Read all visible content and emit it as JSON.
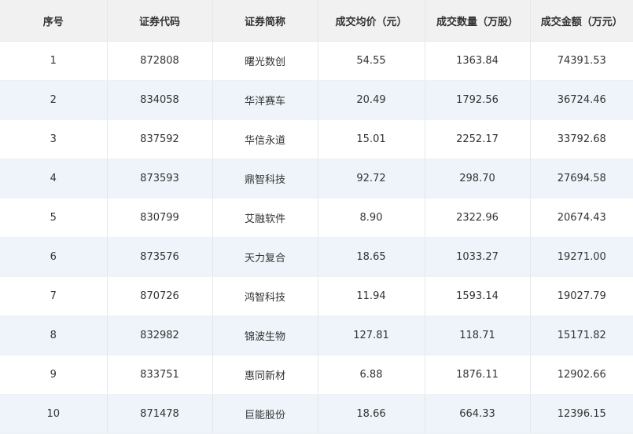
{
  "table": {
    "headers": [
      "序号",
      "证券代码",
      "证券简称",
      "成交均价（元）",
      "成交数量（万股）",
      "成交金额（万元）"
    ],
    "rows": [
      [
        "1",
        "872808",
        "曙光数创",
        "54.55",
        "1363.84",
        "74391.53"
      ],
      [
        "2",
        "834058",
        "华洋赛车",
        "20.49",
        "1792.56",
        "36724.46"
      ],
      [
        "3",
        "837592",
        "华信永道",
        "15.01",
        "2252.17",
        "33792.68"
      ],
      [
        "4",
        "873593",
        "鼎智科技",
        "92.72",
        "298.70",
        "27694.58"
      ],
      [
        "5",
        "830799",
        "艾融软件",
        "8.90",
        "2322.96",
        "20674.43"
      ],
      [
        "6",
        "873576",
        "天力复合",
        "18.65",
        "1033.27",
        "19271.00"
      ],
      [
        "7",
        "870726",
        "鸿智科技",
        "11.94",
        "1593.14",
        "19027.79"
      ],
      [
        "8",
        "832982",
        "锦波生物",
        "127.81",
        "118.71",
        "15171.82"
      ],
      [
        "9",
        "833751",
        "惠同新材",
        "6.88",
        "1876.11",
        "12902.66"
      ],
      [
        "10",
        "871478",
        "巨能股份",
        "18.66",
        "664.33",
        "12396.15"
      ]
    ]
  }
}
